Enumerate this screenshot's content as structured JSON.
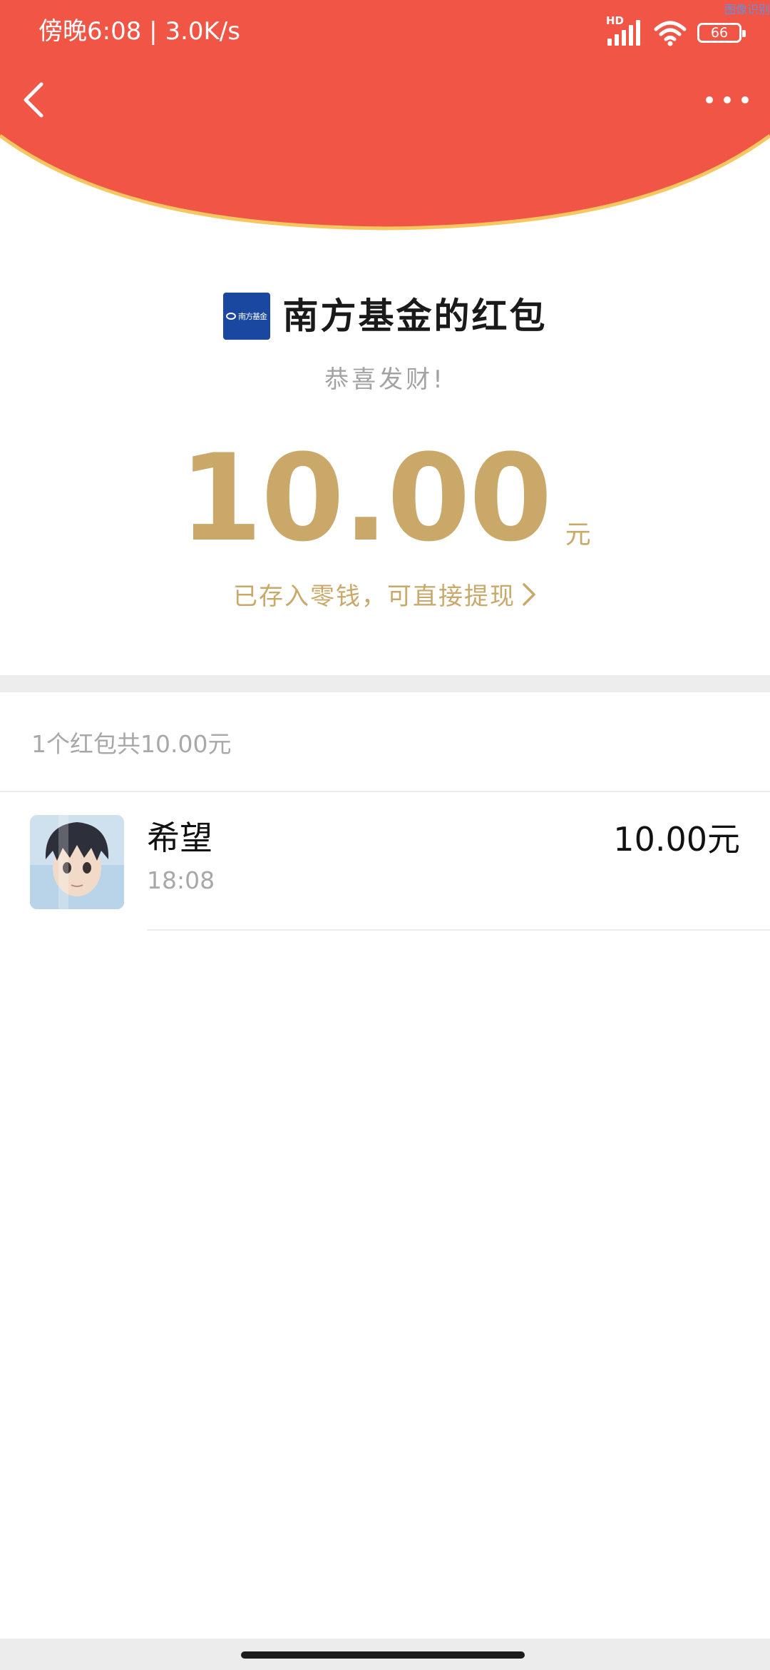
{
  "status_bar": {
    "time": "傍晚6:08",
    "network_speed": "3.0K/s",
    "network_type": "HD",
    "battery_level": "66",
    "corner_text": "图像识别"
  },
  "nav": {
    "back_icon": "chevron-left-icon",
    "more_icon": "more-dots-icon"
  },
  "packet": {
    "sender_logo_text": "南方基金",
    "sender_title": "南方基金的红包",
    "greeting": "恭喜发财!",
    "amount": "10.00",
    "amount_unit": "元",
    "deposit_text": "已存入零钱，可直接提现",
    "deposit_icon": "chevron-right-icon"
  },
  "summary": {
    "text": "1个红包共10.00元"
  },
  "recipients": [
    {
      "name": "希望",
      "time": "18:08",
      "amount": "10.00元"
    }
  ],
  "colors": {
    "header_red": "#f05546",
    "header_border": "#f6c760",
    "gold": "#c9a86a",
    "logo_blue": "#1a47a0"
  }
}
